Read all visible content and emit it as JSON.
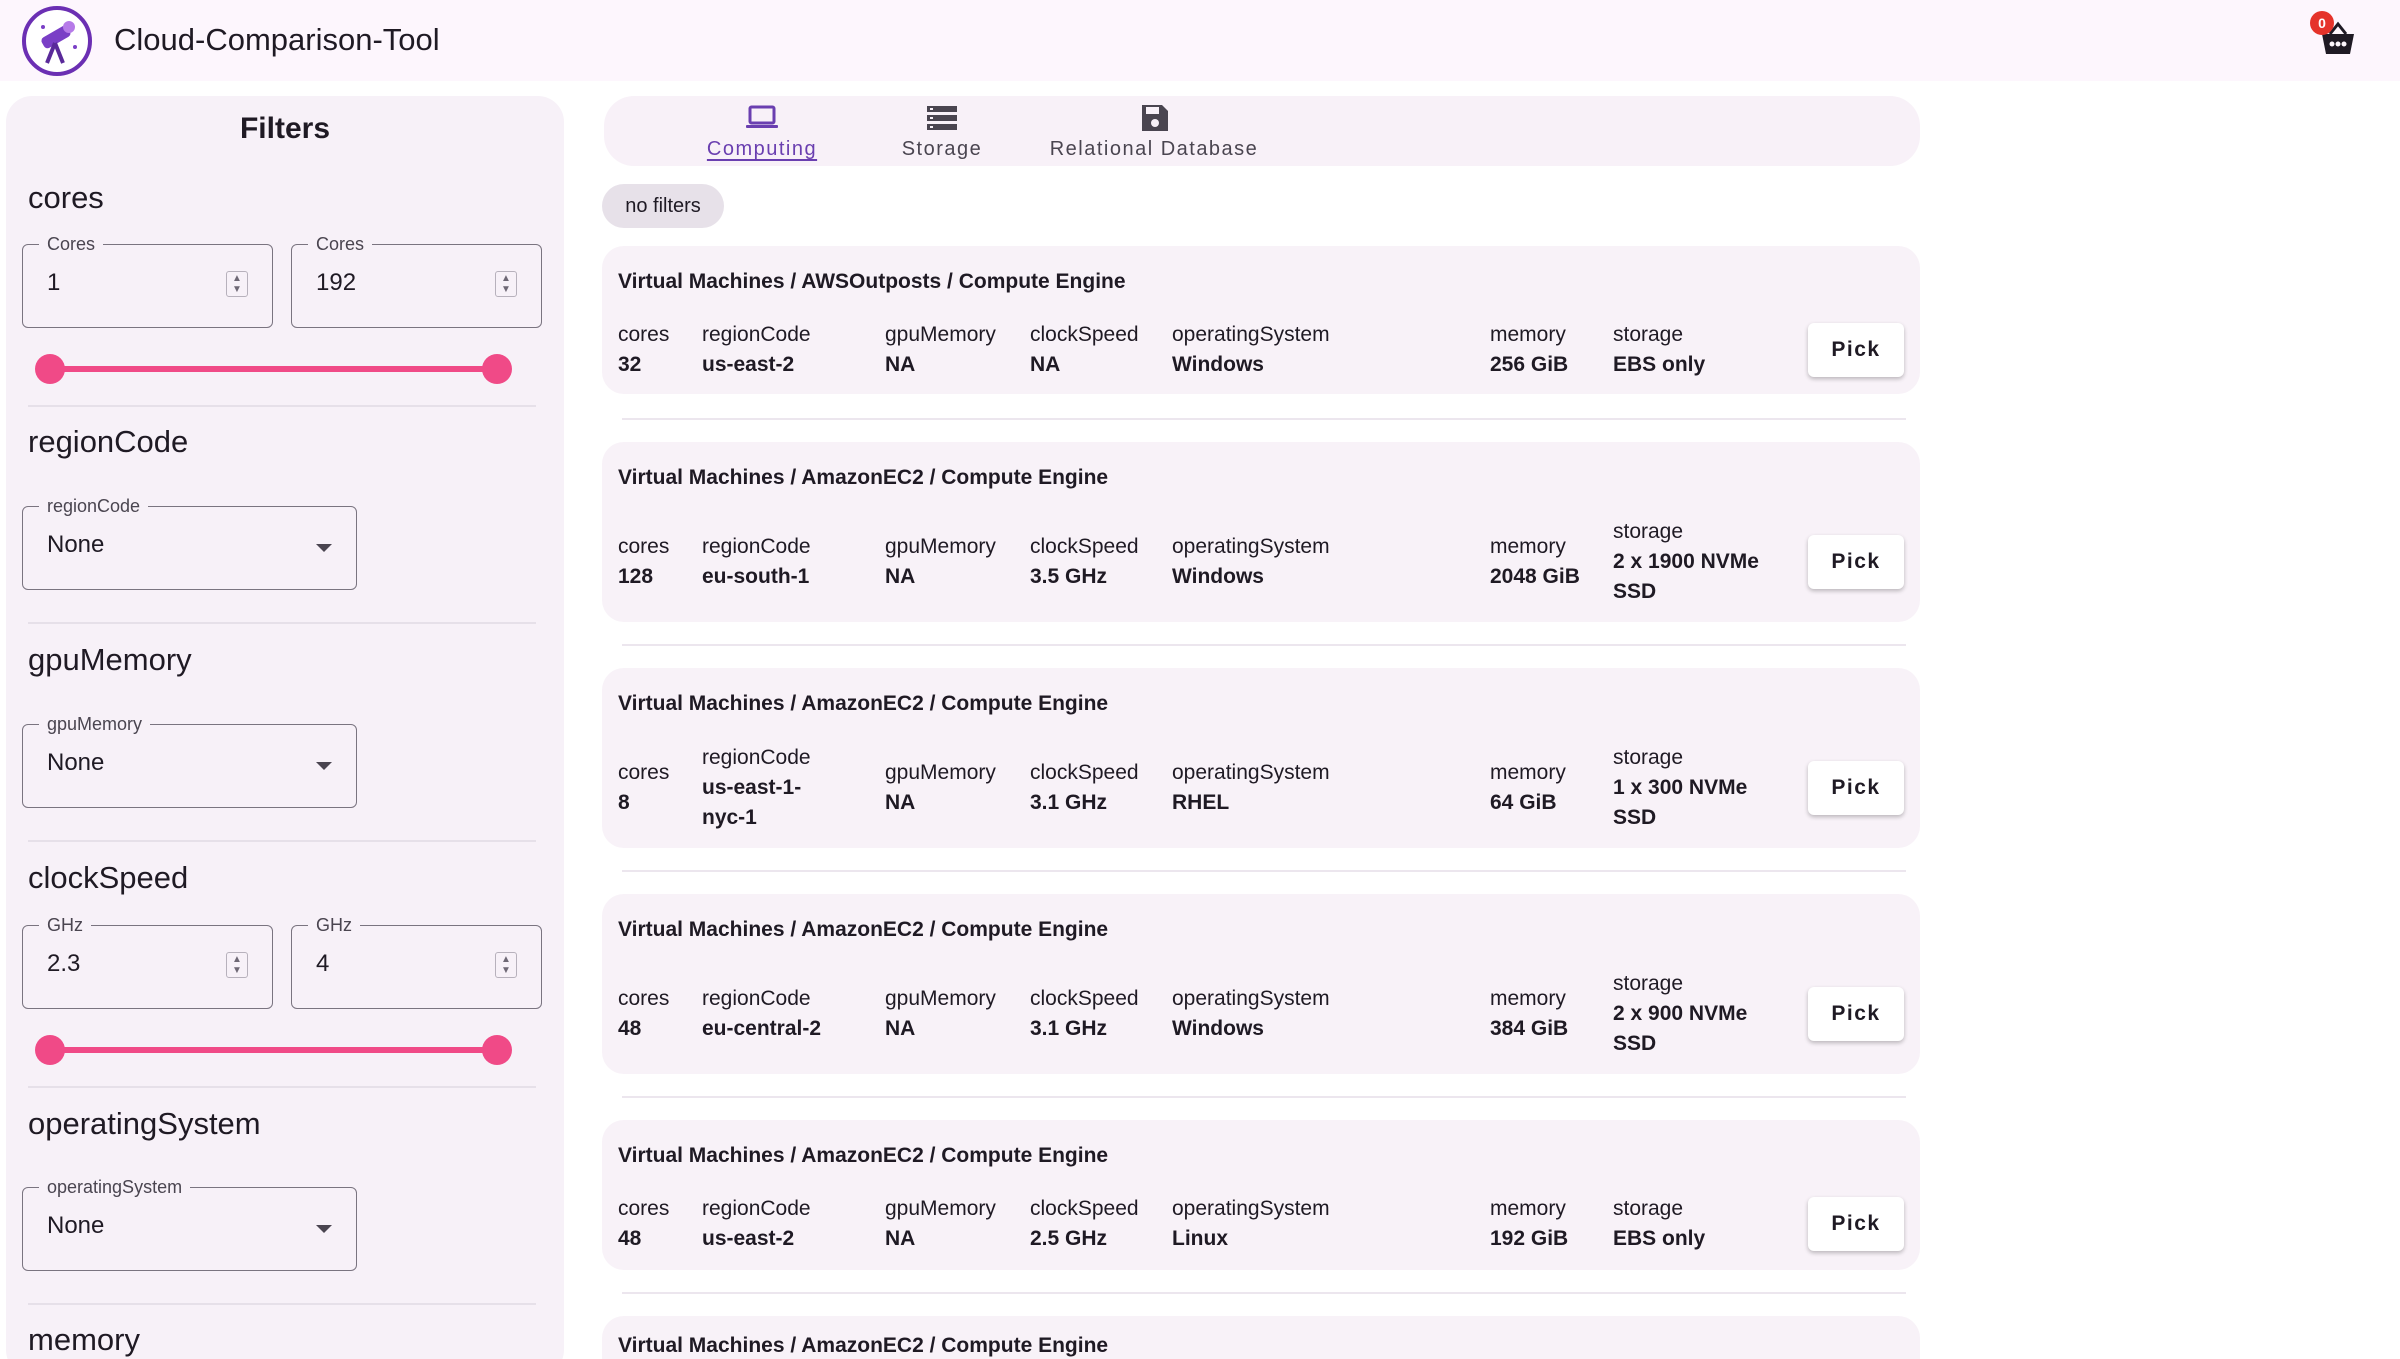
{
  "app": {
    "title": "Cloud-Comparison-Tool",
    "cart_count": "0"
  },
  "sidebar": {
    "title": "Filters",
    "cores": {
      "label": "cores",
      "min_label": "Cores",
      "min_value": "1",
      "max_label": "Cores",
      "max_value": "192"
    },
    "regionCode": {
      "label": "regionCode",
      "field_label": "regionCode",
      "value": "None"
    },
    "gpuMemory": {
      "label": "gpuMemory",
      "field_label": "gpuMemory",
      "value": "None"
    },
    "clockSpeed": {
      "label": "clockSpeed",
      "min_label": "GHz",
      "min_value": "2.3",
      "max_label": "GHz",
      "max_value": "4"
    },
    "operatingSystem": {
      "label": "operatingSystem",
      "field_label": "operatingSystem",
      "value": "None"
    },
    "memory": {
      "label": "memory"
    }
  },
  "tabs": [
    {
      "label": "Computing",
      "icon": "laptop-icon",
      "active": true
    },
    {
      "label": "Storage",
      "icon": "storage-icon",
      "active": false
    },
    {
      "label": "Relational Database",
      "icon": "floppy-disk-icon",
      "active": false
    }
  ],
  "chip": "no filters",
  "labels": {
    "cores": "cores",
    "regionCode": "regionCode",
    "gpuMemory": "gpuMemory",
    "clockSpeed": "clockSpeed",
    "operatingSystem": "operatingSystem",
    "memory": "memory",
    "storage": "storage",
    "pick": "Pick"
  },
  "results": [
    {
      "title": "Virtual Machines / AWSOutposts / Compute Engine",
      "cores": "32",
      "regionCode": [
        "us-east-2"
      ],
      "gpuMemory": "NA",
      "clockSpeed": "NA",
      "operatingSystem": "Windows",
      "memory": "256 GiB",
      "storage": [
        "EBS only"
      ]
    },
    {
      "title": "Virtual Machines / AmazonEC2 / Compute Engine",
      "cores": "128",
      "regionCode": [
        "eu-south-1"
      ],
      "gpuMemory": "NA",
      "clockSpeed": "3.5 GHz",
      "operatingSystem": "Windows",
      "memory": "2048 GiB",
      "storage": [
        "2 x 1900 NVMe",
        "SSD"
      ]
    },
    {
      "title": "Virtual Machines / AmazonEC2 / Compute Engine",
      "cores": "8",
      "regionCode": [
        "us-east-1-",
        "nyc-1"
      ],
      "gpuMemory": "NA",
      "clockSpeed": "3.1 GHz",
      "operatingSystem": "RHEL",
      "memory": "64 GiB",
      "storage": [
        "1 x 300 NVMe",
        "SSD"
      ]
    },
    {
      "title": "Virtual Machines / AmazonEC2 / Compute Engine",
      "cores": "48",
      "regionCode": [
        "eu-central-2"
      ],
      "gpuMemory": "NA",
      "clockSpeed": "3.1 GHz",
      "operatingSystem": "Windows",
      "memory": "384 GiB",
      "storage": [
        "2 x 900 NVMe",
        "SSD"
      ]
    },
    {
      "title": "Virtual Machines / AmazonEC2 / Compute Engine",
      "cores": "48",
      "regionCode": [
        "us-east-2"
      ],
      "gpuMemory": "NA",
      "clockSpeed": "2.5 GHz",
      "operatingSystem": "Linux",
      "memory": "192 GiB",
      "storage": [
        "EBS only"
      ]
    },
    {
      "title": "Virtual Machines / AmazonEC2 / Compute Engine"
    }
  ],
  "colors": {
    "accent": "#6a3fb0",
    "slider": "#f04a87",
    "badge": "#e5332a",
    "surface": "#f8f2f8"
  }
}
